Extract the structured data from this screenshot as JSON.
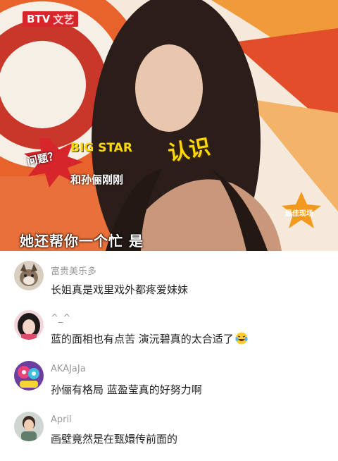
{
  "video": {
    "channel_logo": "BTV",
    "channel_sub": "文艺",
    "overlay_question": "问题？",
    "overlay_big_star": "BIG STAR",
    "overlay_sub": "和孙俪刚刚",
    "overlay_word": "认识",
    "badge_text": "最佳现场",
    "subtitle": "她还帮你一个忙 是"
  },
  "comments": [
    {
      "username": "富贵美乐多",
      "text": "长姐真是戏里戏外都疼爱妹妹",
      "avatar": "dog-avatar"
    },
    {
      "username": "^_^",
      "text": "蓝的面相也有点苦 演沅碧真的太合适了",
      "avatar": "girl-avatar",
      "emoji": "crying-laughing-emoji"
    },
    {
      "username": "AKAJaJa",
      "text": "孙俪有格局 蓝盈莹真的好努力啊",
      "avatar": "cartoon-avatar"
    },
    {
      "username": "April",
      "text": "画壁竟然是在甄嬛传前面的",
      "avatar": "child-avatar"
    }
  ],
  "colors": {
    "accent_red": "#d6262c",
    "username_gray": "#9a9a9a",
    "text_dark": "#222222"
  }
}
